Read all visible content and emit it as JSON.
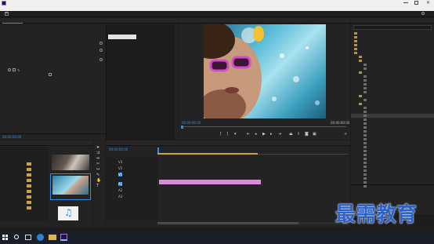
{
  "titlebar": {
    "title": "",
    "colors": {
      "bg": "#f0f0f0",
      "text": "#222222"
    }
  },
  "menubar": {
    "items": [
      "",
      "",
      "",
      "",
      "",
      "",
      "",
      ""
    ]
  },
  "workspace": {
    "tabs": [
      "",
      "",
      "",
      "",
      "",
      "",
      "",
      ""
    ],
    "active_index": 5
  },
  "effect_controls": {
    "tabs": [
      "",
      "",
      ""
    ],
    "clip_label": "",
    "header": [
      "",
      "",
      ""
    ],
    "rows": [
      "",
      "",
      "",
      "",
      "",
      "",
      "",
      "",
      "",
      "",
      "",
      "",
      "",
      ""
    ]
  },
  "program_monitor": {
    "tab_label": "",
    "timecode_left": "00:00:00:00",
    "fit_label": "",
    "timecode_right": "00:00:00:00",
    "fraction_label": ""
  },
  "project_panel": {
    "tabs": [
      "",
      ""
    ],
    "items": [
      "",
      ""
    ]
  },
  "timeline": {
    "tab_label": "",
    "timecode": "00:00:00:00",
    "clip_label": "",
    "track_labels": [
      "V3",
      "V2",
      "V1",
      "A1",
      "A2",
      "A3"
    ]
  },
  "effects_panel": {
    "title": "",
    "search_value": "",
    "items": [
      "",
      "",
      "",
      "",
      "",
      "",
      "",
      "",
      "",
      "",
      "",
      "",
      "",
      "",
      "",
      "",
      "",
      "",
      "",
      "",
      "",
      "",
      "",
      "",
      "",
      "",
      "",
      "",
      "",
      "",
      "",
      "",
      "",
      "",
      "",
      "",
      "",
      "",
      "",
      ""
    ],
    "selected_index": 21,
    "bottom_items": [
      "",
      "",
      ""
    ]
  },
  "taskbar": {
    "time": "",
    "date": "",
    "watermark": "最需教育",
    "colors": {
      "bg": "#1b1f2a",
      "watermark": "#2d63c8"
    }
  },
  "colors": {
    "accent": "#2d8ceb",
    "clip": "#d88cd9",
    "playhead": "#4a90e2"
  }
}
